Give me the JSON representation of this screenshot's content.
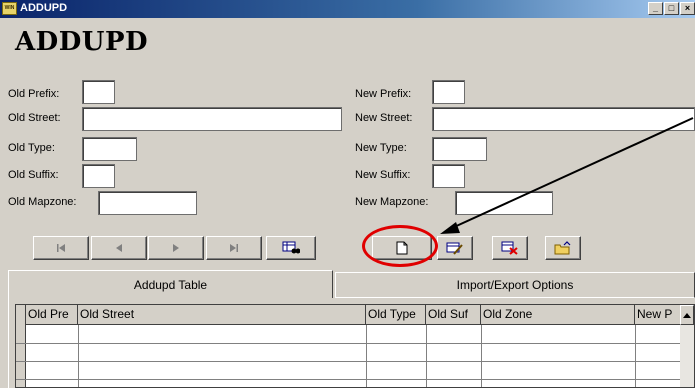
{
  "window": {
    "title": "ADDUPD",
    "app_icon_text": "WIN"
  },
  "form": {
    "heading": "ADDUPD",
    "old_prefix_label": "Old Prefix:",
    "old_street_label": "Old Street:",
    "old_type_label": "Old Type:",
    "old_suffix_label": "Old Suffix:",
    "old_mapzone_label": "Old Mapzone:",
    "new_prefix_label": "New Prefix:",
    "new_street_label": "New Street:",
    "new_type_label": "New Type:",
    "new_suffix_label": "New Suffix:",
    "new_mapzone_label": "New Mapzone:",
    "old_prefix_value": "",
    "old_street_value": "",
    "old_type_value": "",
    "old_suffix_value": "",
    "old_mapzone_value": "",
    "new_prefix_value": "",
    "new_street_value": "",
    "new_type_value": "",
    "new_suffix_value": "",
    "new_mapzone_value": ""
  },
  "toolbar": {
    "icons": [
      "first-record-icon",
      "previous-record-icon",
      "next-record-icon",
      "last-record-icon",
      "find-icon",
      "new-record-icon",
      "edit-record-icon",
      "delete-record-icon",
      "open-folder-icon"
    ],
    "highlight_color": "#e00000"
  },
  "tabs": [
    {
      "label": "Addupd Table",
      "active": true
    },
    {
      "label": "Import/Export Options",
      "active": false
    }
  ],
  "grid": {
    "columns": [
      "Old Pre",
      "Old Street",
      "Old Type",
      "Old Suf",
      "Old Zone",
      "New P"
    ],
    "rows": []
  }
}
